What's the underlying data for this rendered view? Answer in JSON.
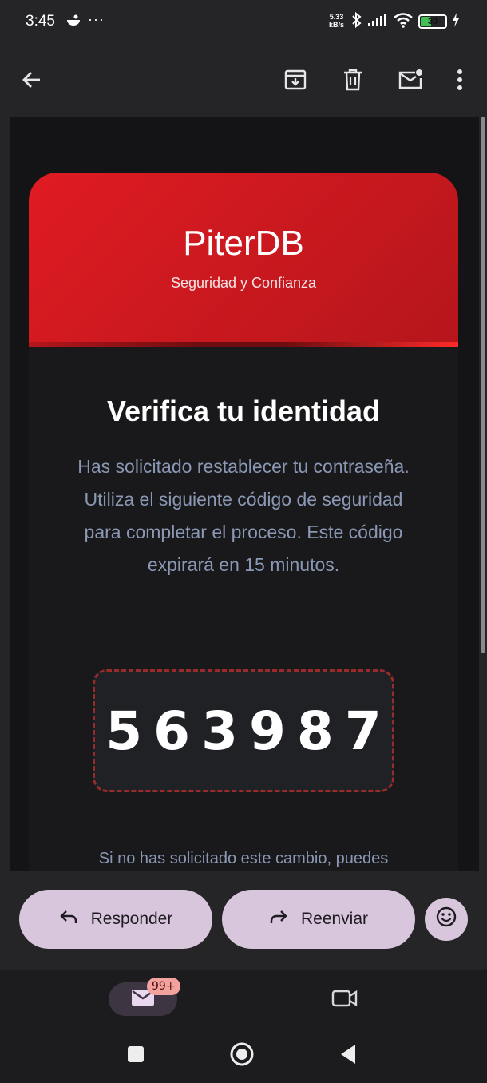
{
  "status_bar": {
    "time": "3:45",
    "more": "···",
    "net_speed_value": "5.33",
    "net_speed_unit": "kB/s",
    "battery": "30"
  },
  "toolbar": {
    "back_icon": "arrow-left-icon",
    "archive_icon": "archive-icon",
    "delete_icon": "trash-icon",
    "mark_unread_icon": "mail-unread-icon",
    "more_icon": "more-vert-icon"
  },
  "email": {
    "brand_title": "PiterDB",
    "brand_subtitle": "Seguridad y Confianza",
    "heading": "Verifica tu identidad",
    "description": "Has solicitado restablecer tu contraseña. Utiliza el siguiente código de seguridad para completar el proceso. Este código expirará en 15 minutos.",
    "code": "563987",
    "note": "Si no has solicitado este cambio, puedes"
  },
  "reply_bar": {
    "reply_label": "Responder",
    "forward_label": "Reenviar"
  },
  "bottom_nav": {
    "mail_badge": "99+"
  },
  "colors": {
    "accent_red": "#e01b22",
    "pill_bg": "#d8c7dc",
    "text_muted": "#8a98b4"
  }
}
